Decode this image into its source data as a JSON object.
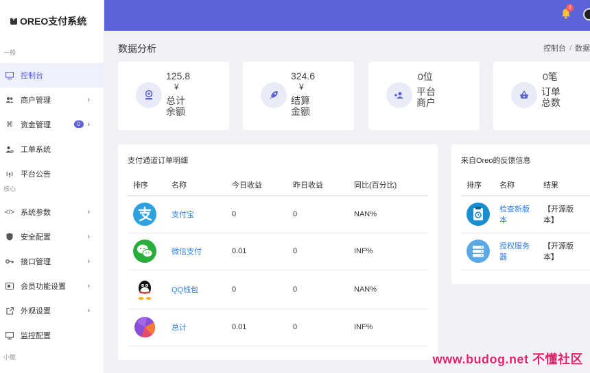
{
  "brand": {
    "title": "OREO支付系统"
  },
  "sidebar": {
    "sections": [
      {
        "label": "一般"
      },
      {
        "label": "核心"
      },
      {
        "label": "小屋"
      }
    ],
    "items": [
      {
        "label": "控制台",
        "icon": "monitor-icon",
        "active": true
      },
      {
        "label": "商户管理",
        "icon": "users-icon"
      },
      {
        "label": "资金管理",
        "icon": "command-icon",
        "badge": "0"
      },
      {
        "label": "工单系统",
        "icon": "user-gear-icon"
      },
      {
        "label": "平台公告",
        "icon": "broadcast-icon"
      },
      {
        "label": "系统参数",
        "icon": "code-icon"
      },
      {
        "label": "安全配置",
        "icon": "shield-icon"
      },
      {
        "label": "接口管理",
        "icon": "key-icon"
      },
      {
        "label": "会员功能设置",
        "icon": "card-icon"
      },
      {
        "label": "外观设置",
        "icon": "external-icon"
      },
      {
        "label": "监控配置",
        "icon": "screen-icon"
      }
    ]
  },
  "header": {
    "notification_count": "0"
  },
  "page": {
    "title": "数据分析",
    "breadcrumb": [
      "控制台",
      "数据"
    ]
  },
  "stats": [
    {
      "value": "125.8",
      "unit": "¥",
      "label": "总计余额",
      "label_lines": [
        "总计",
        "余额"
      ],
      "icon": "wallet-icon"
    },
    {
      "value": "324.6",
      "unit": "¥",
      "label": "结算金额",
      "label_lines": [
        "结算",
        "金额"
      ],
      "icon": "rocket-icon"
    },
    {
      "value": "0位",
      "unit": "",
      "label": "平台商户",
      "label_lines": [
        "平台",
        "商户"
      ],
      "icon": "user-add-icon"
    },
    {
      "value": "0笔",
      "unit": "",
      "label": "订单总数",
      "label_lines": [
        "订单",
        "总数"
      ],
      "icon": "basket-icon"
    }
  ],
  "orders_panel": {
    "title": "支付通道订单明细",
    "columns": [
      "排序",
      "名称",
      "今日收益",
      "昨日收益",
      "同比(百分比)"
    ],
    "rows": [
      {
        "icon": "alipay-icon",
        "name": "支付宝",
        "today": "0",
        "yesterday": "0",
        "ratio": "NAN%"
      },
      {
        "icon": "wechat-pay-icon",
        "name": "微信支付",
        "today": "0.01",
        "yesterday": "0",
        "ratio": "INF%"
      },
      {
        "icon": "qq-wallet-icon",
        "name": "QQ钱包",
        "today": "0",
        "yesterday": "0",
        "ratio": "NAN%"
      },
      {
        "icon": "pie-chart-icon",
        "name": "总计",
        "today": "0.01",
        "yesterday": "0",
        "ratio": "INF%"
      }
    ]
  },
  "feedback_panel": {
    "title": "来自Oreo的反馈信息",
    "columns": [
      "排序",
      "名称",
      "结果"
    ],
    "rows": [
      {
        "icon": "clipboard-icon",
        "name_lines": [
          "检查新版",
          "本"
        ],
        "result_lines": [
          "【开源版",
          "本】"
        ]
      },
      {
        "icon": "server-icon",
        "name_lines": [
          "授权服务",
          "器"
        ],
        "result_lines": [
          "【开源版",
          "本】"
        ]
      }
    ]
  },
  "watermark": "www.budog.net 不懂社区",
  "colors": {
    "accent": "#5b63d6",
    "link": "#2b7de9",
    "bg": "#f1f2f6"
  }
}
